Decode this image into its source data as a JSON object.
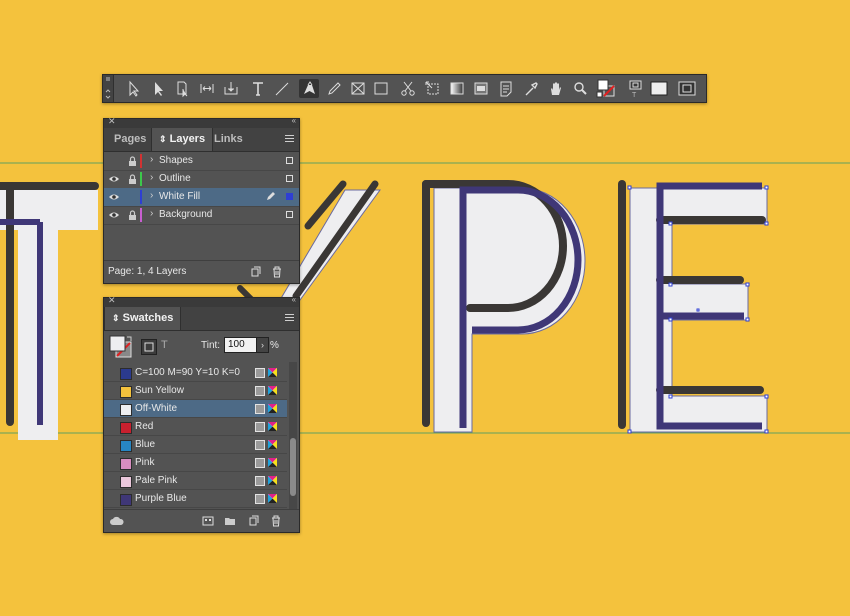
{
  "colors": {
    "background": "#F4C23D",
    "letter_fill": "#EEEEF0",
    "outline": "#3F3777",
    "shadow": "#3A3735",
    "guide": "#5FA05F",
    "panel": "#535353",
    "selection": "#4D6A86"
  },
  "toolbar": {
    "tools": [
      "selection-icon",
      "direct-selection-icon",
      "page-tool-icon",
      "gap-tool-icon",
      "content-collector-icon",
      "type-tool-icon",
      "line-tool-icon",
      "pen-tool-icon",
      "pencil-tool-icon",
      "rectangle-frame-icon",
      "rectangle-tool-icon",
      "scissors-icon",
      "free-transform-icon",
      "gradient-swatch-icon",
      "gradient-feather-icon",
      "note-icon",
      "eyedropper-icon",
      "hand-icon",
      "zoom-icon",
      "fill-stroke-icon",
      "formatting-affects-container-icon",
      "normal-mode-icon",
      "screen-mode-icon"
    ],
    "active_tool": "pen-tool-icon"
  },
  "layers_panel": {
    "tabs": [
      {
        "label": "Pages",
        "active": false
      },
      {
        "label": "Layers",
        "active": true
      },
      {
        "label": "Links",
        "active": false
      }
    ],
    "layers": [
      {
        "name": "Shapes",
        "color": "#D23232",
        "visible": false,
        "locked": true,
        "selected": false
      },
      {
        "name": "Outline",
        "color": "#3CC84B",
        "visible": true,
        "locked": true,
        "selected": false
      },
      {
        "name": "White Fill",
        "color": "#2E3FD3",
        "visible": true,
        "locked": false,
        "selected": true
      },
      {
        "name": "Background",
        "color": "#C85FD0",
        "visible": true,
        "locked": true,
        "selected": false
      }
    ],
    "footer_text": "Page: 1, 4 Layers"
  },
  "swatches_panel": {
    "tab": "Swatches",
    "tint_label": "Tint:",
    "tint_value": "100",
    "tint_unit": "%",
    "swatches": [
      {
        "name": "C=100 M=90 Y=10 K=0",
        "color": "#2B3A8E",
        "selected": false
      },
      {
        "name": "Sun Yellow",
        "color": "#F4C23D",
        "selected": false
      },
      {
        "name": "Off-White",
        "color": "#EEEEF0",
        "selected": true
      },
      {
        "name": "Red",
        "color": "#C8202E",
        "selected": false
      },
      {
        "name": "Blue",
        "color": "#2786C3",
        "selected": false
      },
      {
        "name": "Pink",
        "color": "#D88DC0",
        "selected": false
      },
      {
        "name": "Pale Pink",
        "color": "#EBC8DC",
        "selected": false
      },
      {
        "name": "Purple Blue",
        "color": "#3F3777",
        "selected": false
      }
    ]
  }
}
